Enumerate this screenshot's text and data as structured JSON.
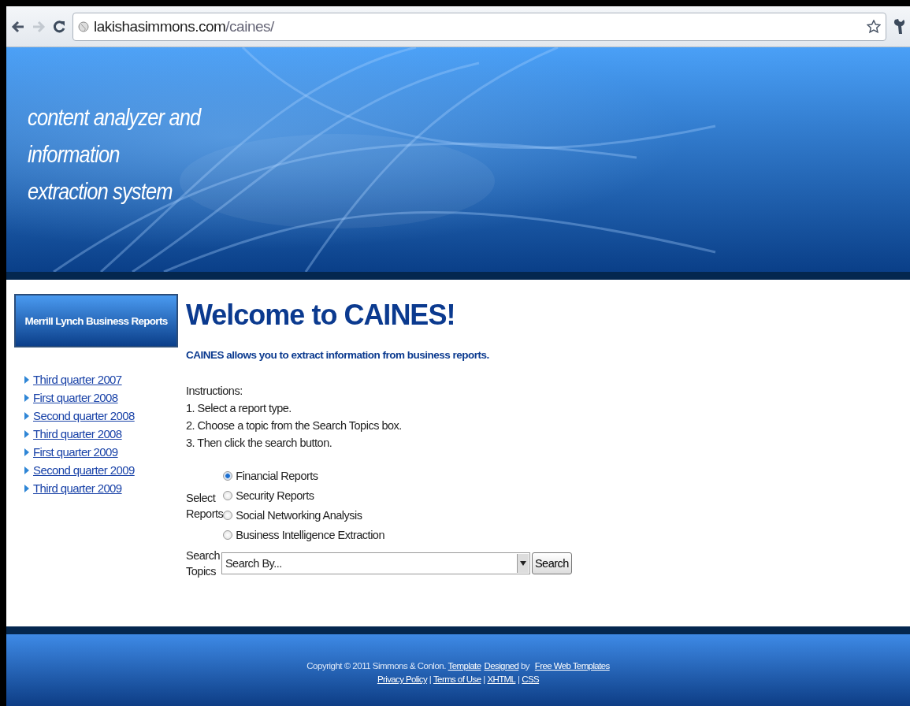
{
  "browser": {
    "url_host": "lakishasimmons.com",
    "url_path": "/caines/"
  },
  "header": {
    "tagline_lines": [
      "content analyzer and",
      "information",
      "extraction system"
    ]
  },
  "sidebar": {
    "title": "Merrill Lynch Business Reports",
    "links": [
      "Third quarter 2007",
      "First quarter 2008",
      "Second quarter 2008",
      "Third quarter 2008",
      "First quarter 2009",
      "Second quarter 2009",
      "Third quarter 2009"
    ]
  },
  "main": {
    "heading": "Welcome to CAINES!",
    "intro": "CAINES allows you to extract information from business reports.",
    "instructions": [
      "Instructions:",
      "1. Select a report type.",
      "2. Choose a topic from the Search Topics box.",
      "3. Then click the search button."
    ],
    "reports_label_lines": [
      "Select",
      "Reports"
    ],
    "reports": [
      {
        "label": "Financial Reports",
        "selected": true
      },
      {
        "label": "Security Reports",
        "selected": false
      },
      {
        "label": "Social Networking Analysis",
        "selected": false
      },
      {
        "label": "Business Intelligence Extraction",
        "selected": false
      }
    ],
    "topics_label_lines": [
      "Search",
      "Topics"
    ],
    "topics_value": "Search By...",
    "search_button": "Search"
  },
  "footer": {
    "line1": [
      {
        "kind": "text",
        "text": "Copyright © 2011 Simmons & Conlon. "
      },
      {
        "kind": "link",
        "text": "Template"
      },
      {
        "kind": "link",
        "text": "Designed"
      },
      {
        "kind": "text",
        "text": " by "
      },
      {
        "kind": "link",
        "text": "Free Web Templates"
      }
    ],
    "line2": [
      {
        "kind": "link",
        "text": "Privacy Policy"
      },
      {
        "kind": "text",
        "text": " | "
      },
      {
        "kind": "link",
        "text": "Terms of Use"
      },
      {
        "kind": "text",
        "text": " | "
      },
      {
        "kind": "link",
        "text": "XHTML"
      },
      {
        "kind": "text",
        "text": " | "
      },
      {
        "kind": "link",
        "text": "CSS"
      }
    ]
  }
}
